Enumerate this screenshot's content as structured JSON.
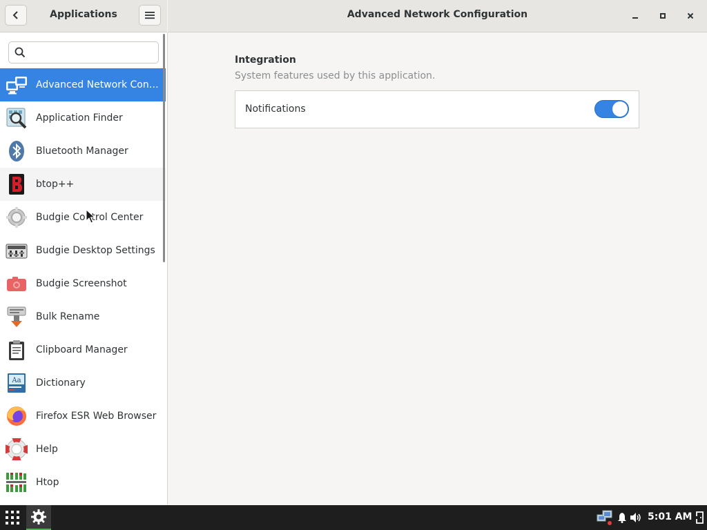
{
  "sidebar": {
    "title": "Applications",
    "search_placeholder": "",
    "items": [
      {
        "label": "Advanced Network Config...",
        "icon": "network-icon"
      },
      {
        "label": "Application Finder",
        "icon": "app-finder-icon"
      },
      {
        "label": "Bluetooth Manager",
        "icon": "bluetooth-icon"
      },
      {
        "label": "btop++",
        "icon": "btop-icon"
      },
      {
        "label": "Budgie Control Center",
        "icon": "gear-icon"
      },
      {
        "label": "Budgie Desktop Settings",
        "icon": "desktop-settings-icon"
      },
      {
        "label": "Budgie Screenshot",
        "icon": "camera-icon"
      },
      {
        "label": "Bulk Rename",
        "icon": "rename-icon"
      },
      {
        "label": "Clipboard Manager",
        "icon": "clipboard-icon"
      },
      {
        "label": "Dictionary",
        "icon": "dictionary-icon"
      },
      {
        "label": "Firefox ESR Web Browser",
        "icon": "firefox-icon"
      },
      {
        "label": "Help",
        "icon": "lifebuoy-icon"
      },
      {
        "label": "Htop",
        "icon": "htop-icon"
      }
    ]
  },
  "main": {
    "title": "Advanced Network Configuration",
    "section_title": "Integration",
    "section_subtitle": "System features used by this application.",
    "notifications_label": "Notifications",
    "notifications_enabled": true
  },
  "taskbar": {
    "clock": "5:01 AM"
  },
  "colors": {
    "accent": "#3584e4",
    "taskbar": "#1e1e1e"
  }
}
